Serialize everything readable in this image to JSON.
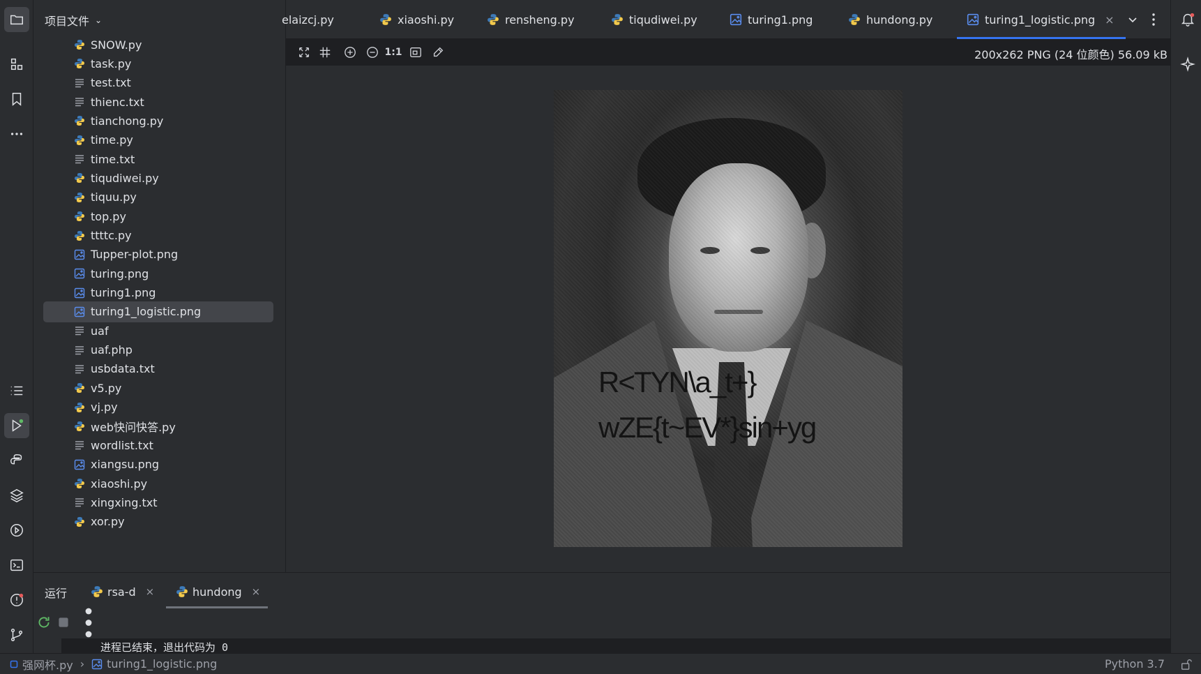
{
  "project": {
    "title": "项目文件",
    "files": [
      {
        "name": "SNOW.py",
        "type": "py"
      },
      {
        "name": "task.py",
        "type": "py"
      },
      {
        "name": "test.txt",
        "type": "txt"
      },
      {
        "name": "thienc.txt",
        "type": "txt"
      },
      {
        "name": "tianchong.py",
        "type": "py"
      },
      {
        "name": "time.py",
        "type": "py"
      },
      {
        "name": "time.txt",
        "type": "txt"
      },
      {
        "name": "tiqudiwei.py",
        "type": "py"
      },
      {
        "name": "tiquu.py",
        "type": "py"
      },
      {
        "name": "top.py",
        "type": "py"
      },
      {
        "name": "ttttc.py",
        "type": "py"
      },
      {
        "name": "Tupper-plot.png",
        "type": "png"
      },
      {
        "name": "turing.png",
        "type": "png"
      },
      {
        "name": "turing1.png",
        "type": "png"
      },
      {
        "name": "turing1_logistic.png",
        "type": "png",
        "selected": true
      },
      {
        "name": "uaf",
        "type": "txt"
      },
      {
        "name": "uaf.php",
        "type": "txt"
      },
      {
        "name": "usbdata.txt",
        "type": "txt"
      },
      {
        "name": "v5.py",
        "type": "py"
      },
      {
        "name": "vj.py",
        "type": "py"
      },
      {
        "name": "web快问快答.py",
        "type": "py"
      },
      {
        "name": "wordlist.txt",
        "type": "txt"
      },
      {
        "name": "xiangsu.png",
        "type": "png"
      },
      {
        "name": "xiaoshi.py",
        "type": "py"
      },
      {
        "name": "xingxing.txt",
        "type": "txt"
      },
      {
        "name": "xor.py",
        "type": "py"
      }
    ]
  },
  "tabs": [
    {
      "label": "elaizcj.py",
      "type": "py",
      "partial": true
    },
    {
      "label": "xiaoshi.py",
      "type": "py"
    },
    {
      "label": "rensheng.py",
      "type": "py"
    },
    {
      "label": "tiqudiwei.py",
      "type": "py"
    },
    {
      "label": "turing1.png",
      "type": "png"
    },
    {
      "label": "hundong.py",
      "type": "py"
    },
    {
      "label": "turing1_logistic.png",
      "type": "png",
      "active": true
    }
  ],
  "image_toolbar": {
    "actual_size_label": "1:1",
    "info": "200x262 PNG (24 位颜色) 56.09 kB"
  },
  "image": {
    "hidden_text_line1": "R<TYN\\a_t+}",
    "hidden_text_line2": "wZE{t~EV*}sin+yg"
  },
  "run_panel": {
    "title": "运行",
    "tabs": [
      {
        "label": "rsa-d"
      },
      {
        "label": "hundong",
        "active": true
      }
    ],
    "console_output": "进程已结束，退出代码为 0"
  },
  "statusbar": {
    "crumbs": [
      "强网杯.py",
      "turing1_logistic.png"
    ],
    "interpreter": "Python 3.7"
  },
  "colors": {
    "accent": "#3574f0",
    "py_blue": "#3d7ab8",
    "py_yellow": "#f2c94c",
    "image_icon": "#5a8dee",
    "notification_dot": "#e55b5b",
    "run_dot": "#5fb865"
  }
}
